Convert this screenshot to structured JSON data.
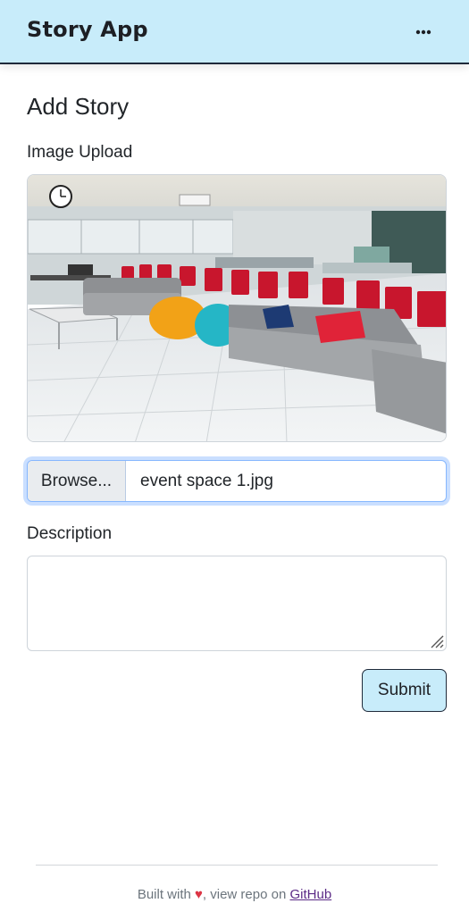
{
  "navbar": {
    "brand": "Story App",
    "menu_icon": "ellipsis-icon"
  },
  "page": {
    "title": "Add Story"
  },
  "form": {
    "image_label": "Image Upload",
    "browse_label": "Browse...",
    "file_name": "event space 1.jpg",
    "description_label": "Description",
    "description_value": "",
    "submit_label": "Submit"
  },
  "footer": {
    "built_with": "Built with",
    "heart": "♥",
    "view_repo": ", view repo on",
    "link_text": "GitHub"
  },
  "colors": {
    "navbar_bg": "#c8ecfa",
    "heart": "#dc3545",
    "focus_ring": "#86b7fe"
  }
}
